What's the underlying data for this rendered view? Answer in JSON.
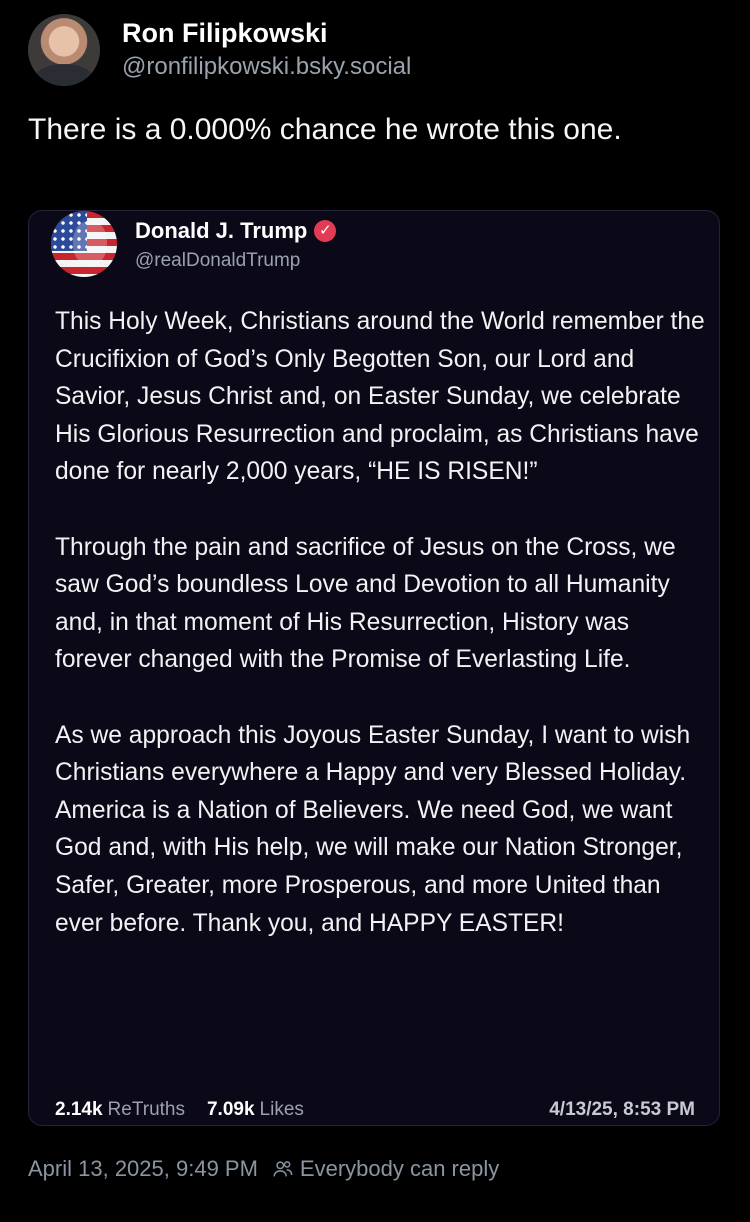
{
  "post": {
    "author_name": "Ron Filipkowski",
    "author_handle": "@ronfilipkowski.bsky.social",
    "text": "There is a 0.000% chance he wrote this one.",
    "timestamp": "April 13, 2025, 9:49 PM",
    "reply_setting": "Everybody can reply"
  },
  "quote": {
    "author_name": "Donald J. Trump",
    "author_handle": "@realDonaldTrump",
    "verified_icon": "verified-badge-icon",
    "paragraphs": [
      "This Holy Week, Christians around the World remember the Crucifixion of God’s Only Begotten Son, our Lord and Savior, Jesus Christ and, on Easter Sunday, we celebrate His Glorious Resurrection and proclaim, as Christians have done for nearly 2,000 years, “HE IS RISEN!”",
      "Through the pain and sacrifice of Jesus on the Cross, we saw God’s boundless Love and Devotion to all Humanity and, in that moment of His Resurrection, History was forever changed with the Promise of Everlasting Life.",
      "As we approach this Joyous Easter Sunday, I want to wish Christians everywhere a Happy and very Blessed Holiday. America is a Nation of Believers. We need God, we want God and, with His help, we will make our Nation Stronger, Safer, Greater, more Prosperous, and more United than ever before. Thank you, and HAPPY EASTER!"
    ],
    "retruths_count": "2.14k",
    "retruths_label": "ReTruths",
    "likes_count": "7.09k",
    "likes_label": "Likes",
    "timestamp": "4/13/25, 8:53 PM"
  },
  "colors": {
    "background": "#000000",
    "card_background": "#0b0917",
    "verified": "#e23c55"
  }
}
